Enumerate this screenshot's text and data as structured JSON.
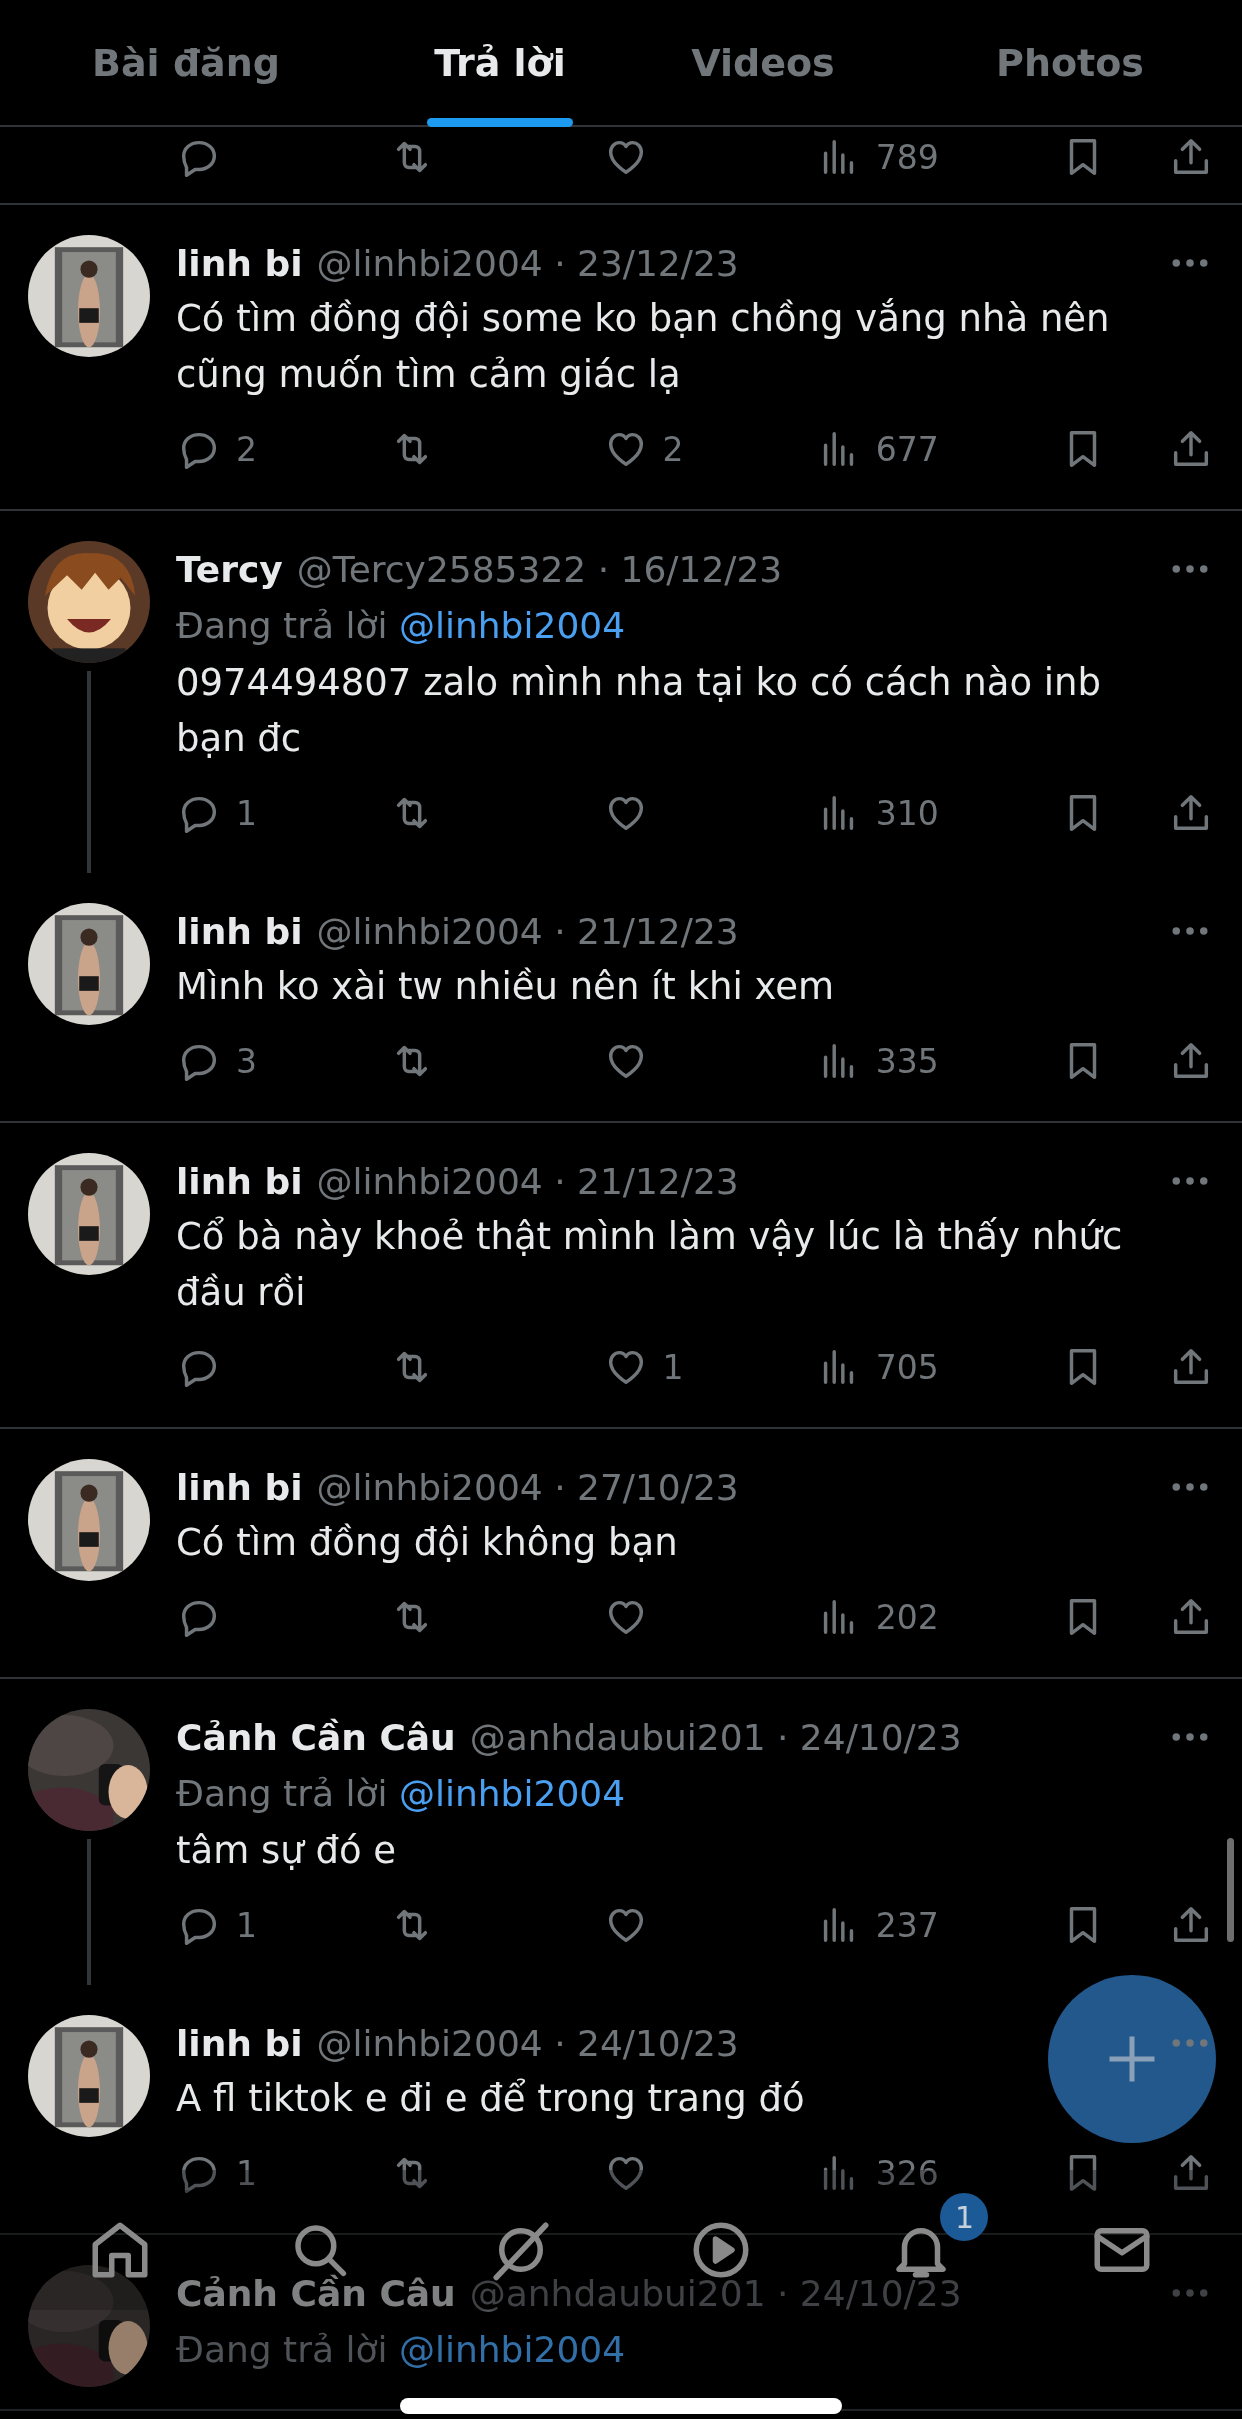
{
  "tabs": [
    {
      "label": "Bài đăng",
      "selected": false
    },
    {
      "label": "Trả lời",
      "selected": true
    },
    {
      "label": "Videos",
      "selected": false
    },
    {
      "label": "Photos",
      "selected": false
    }
  ],
  "partial_actions": {
    "views": "789"
  },
  "tweets": [
    {
      "name": "linh bi",
      "meta": "@linhbi2004 · 23/12/23",
      "text": "Có tìm đồng đội some ko bạn chồng vắng nhà nên cũng muốn tìm cảm giác lạ",
      "replies": "2",
      "likes": "2",
      "views": "677",
      "thread": false
    },
    {
      "name": "Tercy",
      "meta": "@Tercy2585322 · 16/12/23",
      "reply_to": {
        "prefix": "Đang trả lời",
        "mention": "@linhbi2004"
      },
      "text": "0974494807 zalo mình nha tại ko có cách nào inb bạn đc",
      "replies": "1",
      "views": "310",
      "thread": true
    },
    {
      "name": "linh bi",
      "meta": "@linhbi2004 · 21/12/23",
      "text": "Mình ko xài tw nhiều nên ít khi xem",
      "replies": "3",
      "views": "335",
      "thread": false
    },
    {
      "name": "linh bi",
      "meta": "@linhbi2004 · 21/12/23",
      "text": "Cổ bà này khoẻ thật mình làm vậy lúc là thấy nhức đầu rồi",
      "likes": "1",
      "views": "705",
      "thread": false
    },
    {
      "name": "linh bi",
      "meta": "@linhbi2004 · 27/10/23",
      "text": "Có tìm đồng đội không bạn",
      "views": "202",
      "thread": false
    },
    {
      "name": "Cảnh Cần Câu",
      "meta": "@anhdaubui201 · 24/10/23",
      "reply_to": {
        "prefix": "Đang trả lời",
        "mention": "@linhbi2004"
      },
      "text": "tâm sự đó e",
      "replies": "1",
      "views": "237",
      "thread": true
    },
    {
      "name": "linh bi",
      "meta": "@linhbi2004 · 24/10/23",
      "text": "A fl tiktok e đi e để trong trang đó",
      "replies": "1",
      "views": "326",
      "thread": false
    }
  ],
  "partial_tweet": {
    "name": "Cảnh Cần Câu",
    "meta": "@anhdaubui201 · 24/10/23",
    "reply_to": {
      "prefix": "Đang trả lời",
      "mention": "@linhbi2004"
    }
  },
  "nav": {
    "notification_badge": "1"
  }
}
